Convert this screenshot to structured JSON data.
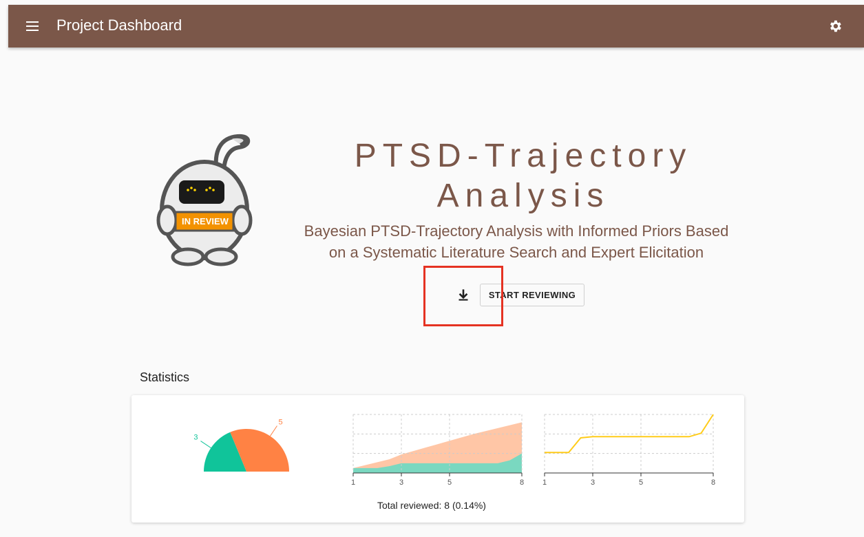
{
  "appbar": {
    "title": "Project Dashboard",
    "menu_icon": "hamburger-menu-icon",
    "settings_icon": "gear-icon",
    "background": "#7b5749"
  },
  "project": {
    "title_line1": "PTSD-Trajectory",
    "title_line2": "Analysis",
    "subtitle_line1": "Bayesian PTSD-Trajectory Analysis with Informed Priors Based",
    "subtitle_line2": "on a Systematic Literature Search and Expert Elicitation",
    "status_badge": "IN REVIEW",
    "accent_color": "#7b5749"
  },
  "actions": {
    "download_icon": "download-icon",
    "start_label": "START REVIEWING"
  },
  "statistics": {
    "heading": "Statistics",
    "total_reviewed_text": "Total reviewed: 8 (0.14%)"
  },
  "chart_data": [
    {
      "type": "pie",
      "labels": [
        "3",
        "5"
      ],
      "values": [
        3,
        5
      ],
      "colors": [
        "#10c49a",
        "#ff8244"
      ]
    },
    {
      "type": "area",
      "x": [
        1,
        2,
        2.5,
        3,
        4,
        5,
        6,
        7,
        7.5,
        8
      ],
      "xticks": [
        "1",
        "3",
        "5",
        "8"
      ],
      "series": [
        {
          "values": [
            0.5,
            0.5,
            0.7,
            1,
            1,
            1,
            1,
            1,
            1.3,
            2.0
          ],
          "color": "#7ad8c0"
        },
        {
          "values": [
            0.5,
            1.1,
            1.4,
            1.9,
            2.6,
            3.3,
            4.0,
            4.6,
            4.9,
            5.2
          ],
          "color": "#ffc6a6"
        }
      ],
      "xlim": [
        1,
        8
      ],
      "ylim": [
        0,
        6
      ],
      "grid": true
    },
    {
      "type": "line",
      "x": [
        1,
        2,
        2.5,
        3,
        4,
        5,
        6,
        7,
        7.5,
        8
      ],
      "xticks": [
        "1",
        "3",
        "5",
        "8"
      ],
      "series": [
        {
          "values": [
            0.35,
            0.35,
            0.6,
            0.62,
            0.62,
            0.62,
            0.62,
            0.62,
            0.68,
            1.0
          ],
          "color": "#ffcc1a"
        }
      ],
      "xlim": [
        1,
        8
      ],
      "ylim": [
        0,
        1
      ],
      "grid": true
    }
  ]
}
